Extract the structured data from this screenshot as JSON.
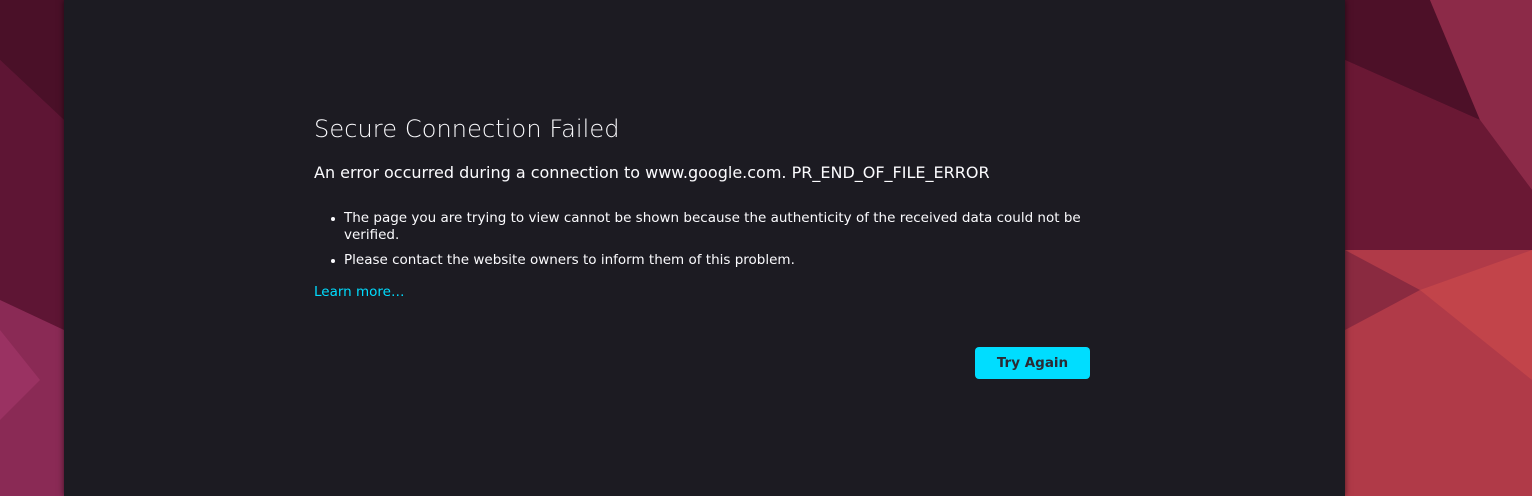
{
  "error_page": {
    "title": "Secure Connection Failed",
    "short_description": "An error occurred during a connection to www.google.com. PR_END_OF_FILE_ERROR",
    "details": [
      "The page you are trying to view cannot be shown because the authenticity of the received data could not be verified.",
      "Please contact the website owners to inform them of this problem."
    ],
    "learn_more": "Learn more…",
    "try_again": "Try Again"
  },
  "colors": {
    "page_background": "#1c1b22",
    "text": "#fbfbfe",
    "accent": "#00ddff",
    "button_text": "#2b2a33",
    "wallpaper": "#7a2040"
  }
}
